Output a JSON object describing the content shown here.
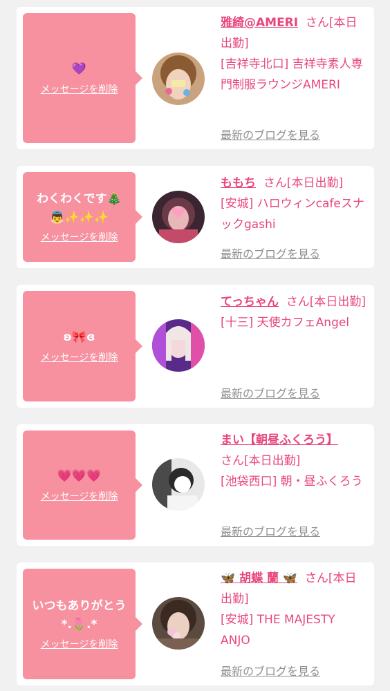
{
  "delete_label": "メッセージを削除",
  "blog_label": "最新のブログを見る",
  "san_suffix": "さん[本日出勤]",
  "colors": {
    "accent": "#e8467c",
    "bubble": "#f7919f",
    "link_gray": "#8f8f8f",
    "background": "#f1f1f1"
  },
  "cards": [
    {
      "message": "💜",
      "name": "雅綺@AMERI",
      "san": "さん[本日出勤]",
      "shop": "[吉祥寺北口] 吉祥寺素人専門制服ラウンジAMERI"
    },
    {
      "message": "わくわくです🎄\n👼✨✨✨",
      "name": "ももち",
      "san": "さん[本日出勤]",
      "shop": "[安城] ハロウィンcafeスナックgashi"
    },
    {
      "message": "ʚ🎀ɞ",
      "name": "てっちゃん",
      "san": "さん[本日出勤]",
      "shop": "[十三] 天使カフェAngel"
    },
    {
      "message": "💗💗💗",
      "name": "まい【朝昼ふくろう】",
      "san": "さん[本日出勤]",
      "shop": "[池袋西口] 朝・昼ふくろう"
    },
    {
      "message": "いつもありがとう\n*.🌷.*",
      "name": "🦋 胡蝶 蘭 🦋",
      "san": "さん[本日出勤]",
      "shop": "[安城] THE MAJESTY ANJO"
    }
  ]
}
